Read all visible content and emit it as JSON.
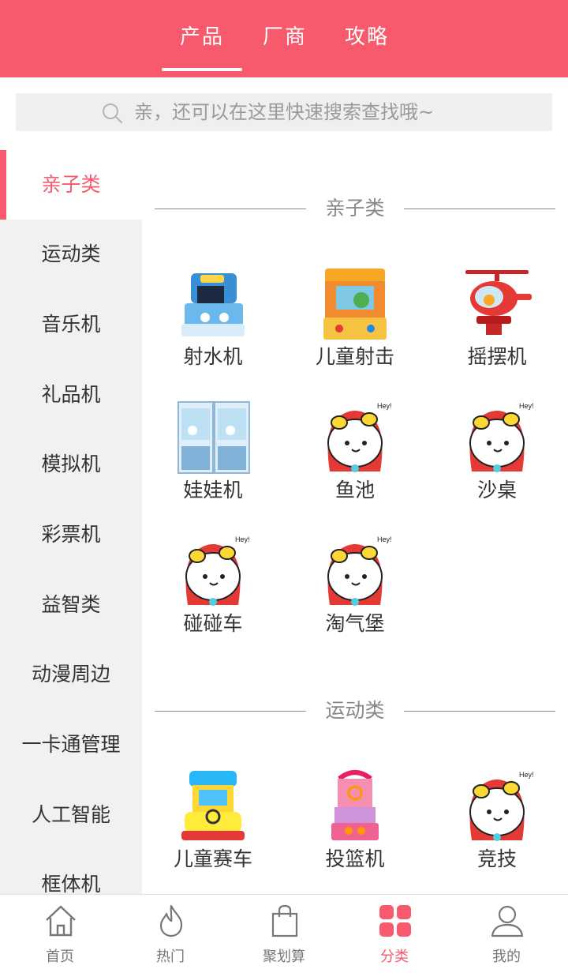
{
  "header": {
    "tabs": [
      {
        "label": "产品"
      },
      {
        "label": "厂商"
      },
      {
        "label": "攻略"
      }
    ]
  },
  "search": {
    "placeholder": "亲，还可以在这里快速搜索查找哦~"
  },
  "sidebar": {
    "items": [
      {
        "label": "亲子类"
      },
      {
        "label": "运动类"
      },
      {
        "label": "音乐机"
      },
      {
        "label": "礼品机"
      },
      {
        "label": "模拟机"
      },
      {
        "label": "彩票机"
      },
      {
        "label": "益智类"
      },
      {
        "label": "动漫周边"
      },
      {
        "label": "一卡通管理"
      },
      {
        "label": "人工智能"
      },
      {
        "label": "框体机"
      }
    ]
  },
  "sections": [
    {
      "title": "亲子类",
      "items": [
        {
          "label": "射水机",
          "icon": "water-shooter-machine-image"
        },
        {
          "label": "儿童射击",
          "icon": "kids-shooting-machine-image"
        },
        {
          "label": "摇摆机",
          "icon": "rocking-helicopter-image"
        },
        {
          "label": "娃娃机",
          "icon": "claw-machine-image"
        },
        {
          "label": "鱼池",
          "icon": "placeholder-cartoon-image"
        },
        {
          "label": "沙桌",
          "icon": "placeholder-cartoon-image"
        },
        {
          "label": "碰碰车",
          "icon": "placeholder-cartoon-image"
        },
        {
          "label": "淘气堡",
          "icon": "placeholder-cartoon-image"
        }
      ]
    },
    {
      "title": "运动类",
      "items": [
        {
          "label": "儿童赛车",
          "icon": "kids-racing-machine-image"
        },
        {
          "label": "投篮机",
          "icon": "basketball-machine-image"
        },
        {
          "label": "竞技",
          "icon": "placeholder-cartoon-image"
        }
      ]
    }
  ],
  "bottom_nav": {
    "items": [
      {
        "label": "首页",
        "icon": "home-icon"
      },
      {
        "label": "热门",
        "icon": "flame-icon"
      },
      {
        "label": "聚划算",
        "icon": "shopping-bag-icon"
      },
      {
        "label": "分类",
        "icon": "grid-icon"
      },
      {
        "label": "我的",
        "icon": "user-icon"
      }
    ]
  },
  "colors": {
    "accent": "#f65a6c",
    "sidebar_bg": "#f1f1f1",
    "search_bg": "#efefef"
  }
}
